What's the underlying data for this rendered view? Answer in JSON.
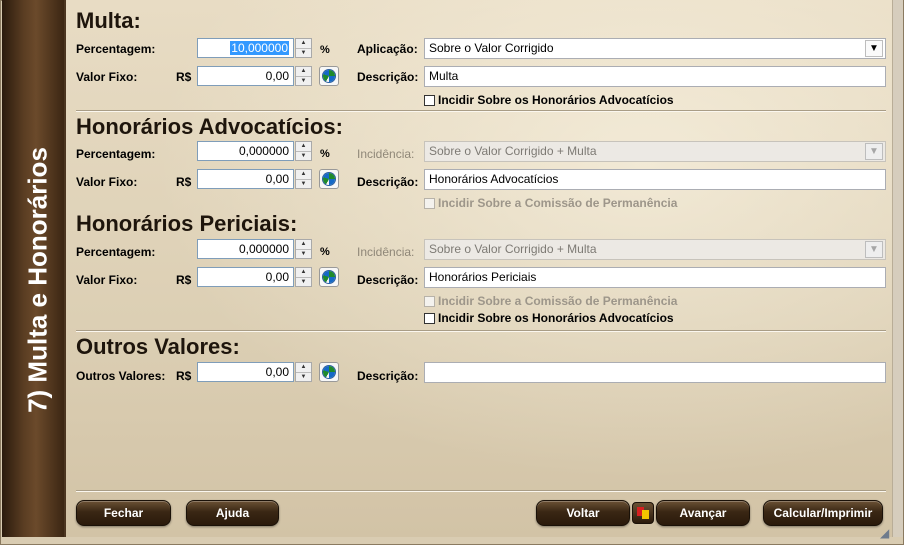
{
  "sidebar": {
    "title": "7) Multa e Honorários"
  },
  "multa": {
    "heading": "Multa:",
    "percent_label": "Percentagem:",
    "percent_value": "10,000000",
    "percent_symbol": "%",
    "fixed_label": "Valor Fixo:",
    "currency": "R$",
    "fixed_value": "0,00",
    "apply_label": "Aplicação:",
    "apply_value": "Sobre o Valor Corrigido",
    "desc_label": "Descrição:",
    "desc_value": "Multa",
    "chk_honorarios": "Incidir Sobre os Honorários Advocatícios"
  },
  "honorarios": {
    "heading": "Honorários Advocatícios:",
    "percent_label": "Percentagem:",
    "percent_value": "0,000000",
    "percent_symbol": "%",
    "fixed_label": "Valor Fixo:",
    "currency": "R$",
    "fixed_value": "0,00",
    "incidence_label": "Incidência:",
    "incidence_value": "Sobre o Valor Corrigido + Multa",
    "desc_label": "Descrição:",
    "desc_value": "Honorários Advocatícios",
    "chk_comissao": "Incidir Sobre a Comissão de Permanência"
  },
  "periciais": {
    "heading": "Honorários Periciais:",
    "percent_label": "Percentagem:",
    "percent_value": "0,000000",
    "percent_symbol": "%",
    "fixed_label": "Valor Fixo:",
    "currency": "R$",
    "fixed_value": "0,00",
    "incidence_label": "Incidência:",
    "incidence_value": "Sobre o Valor Corrigido + Multa",
    "desc_label": "Descrição:",
    "desc_value": "Honorários Periciais",
    "chk_comissao": "Incidir Sobre a Comissão de Permanência",
    "chk_honorarios": "Incidir Sobre os Honorários Advocatícios"
  },
  "outros": {
    "heading": "Outros Valores:",
    "value_label": "Outros Valores:",
    "currency": "R$",
    "value": "0,00",
    "desc_label": "Descrição:",
    "desc_value": ""
  },
  "footer": {
    "close": "Fechar",
    "help": "Ajuda",
    "back": "Voltar",
    "next": "Avançar",
    "calc": "Calcular/Imprimir"
  },
  "colors": {
    "sidebar": "#4a3119",
    "button": "#3a2714",
    "selection": "#3399ff"
  }
}
